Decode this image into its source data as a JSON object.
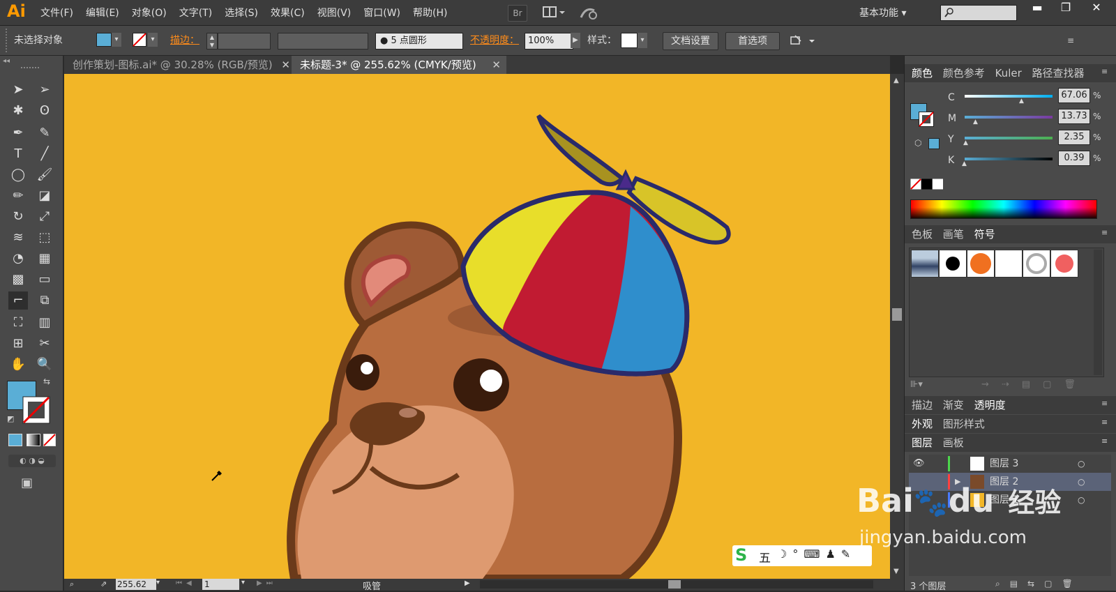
{
  "app": {
    "logo": "Ai"
  },
  "menu": [
    "文件(F)",
    "编辑(E)",
    "对象(O)",
    "文字(T)",
    "选择(S)",
    "效果(C)",
    "视图(V)",
    "窗口(W)",
    "帮助(H)"
  ],
  "menubar": {
    "bridge": "Br",
    "workspace": "基本功能"
  },
  "control": {
    "selection_status": "未选择对象",
    "stroke_label": "描边：",
    "brush_label": "5 点圆形",
    "opacity_label": "不透明度：",
    "opacity_value": "100%",
    "style_label": "样式：",
    "doc_setup": "文档设置",
    "preferences": "首选项"
  },
  "tabs": [
    {
      "label": "创作策划-图标.ai* @ 30.28% (RGB/预览)",
      "active": false
    },
    {
      "label": "未标题-3* @ 255.62% (CMYK/预览)",
      "active": true
    }
  ],
  "status": {
    "zoom": "255.62",
    "artboard": "1",
    "tool": "吸管"
  },
  "color_panel": {
    "tabs": [
      "颜色",
      "颜色参考",
      "Kuler",
      "路径查找器"
    ],
    "channels": [
      {
        "name": "C",
        "value": "67.06",
        "unit": "%",
        "fraction": 0.67
      },
      {
        "name": "M",
        "value": "13.73",
        "unit": "%",
        "fraction": 0.14
      },
      {
        "name": "Y",
        "value": "2.35",
        "unit": "%",
        "fraction": 0.02
      },
      {
        "name": "K",
        "value": "0.39",
        "unit": "%",
        "fraction": 0.004
      }
    ]
  },
  "swatch_panel": {
    "tabs": [
      "色板",
      "画笔",
      "符号"
    ]
  },
  "stroke_panel": {
    "tabs": [
      "描边",
      "渐变",
      "透明度"
    ]
  },
  "appearance_panel": {
    "tabs": [
      "外观",
      "图形样式"
    ]
  },
  "layers_panel": {
    "tabs": [
      "图层",
      "画板"
    ],
    "layers": [
      {
        "name": "图层 3",
        "color": "#4cd64c"
      },
      {
        "name": "图层 2",
        "color": "#ff4040"
      },
      {
        "name": "图层 1",
        "color": "#4a7bff"
      }
    ],
    "count_label": "3 个图层"
  },
  "colors": {
    "fill": "#5aaed6",
    "canvas": "#f2b627",
    "accent": "#ff8c1a"
  },
  "watermark": {
    "brand": "Bai",
    "brand2": "du",
    "brand_cn": "经验",
    "url": "jingyan.baidu.com"
  },
  "ime": {
    "label": "五"
  }
}
